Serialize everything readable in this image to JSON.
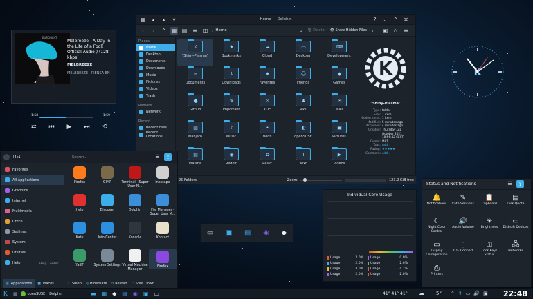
{
  "media": {
    "art_brand": "EUROBEAT",
    "title": "Melbreeze - A Day in the Life of a Fool( Official Audio ) (128 kbps)",
    "artist": "MELBREEZE",
    "album": "MELBREEZE - PIENSA EN",
    "time_elapsed": "1:58",
    "time_remaining": "-1:59",
    "progress": 0.5
  },
  "dolphin": {
    "title": "Home — Dolphin",
    "breadcrumb": "Home",
    "delete_label": "Delete",
    "show_hidden_label": "Show Hidden Files",
    "places_header": "Places",
    "places": [
      "Home",
      "Desktop",
      "Documents",
      "Downloads",
      "Music",
      "Pictures",
      "Videos",
      "Trash"
    ],
    "remote_header": "Remote",
    "remote": [
      "Network"
    ],
    "recent_header": "Recent",
    "recent": [
      "Recent Files",
      "Recent Locations"
    ],
    "files": [
      {
        "name": "\"Shiny-Plasma\"",
        "glyph": "K"
      },
      {
        "name": "Bookmarks",
        "glyph": "★"
      },
      {
        "name": "Cloud",
        "glyph": "☁"
      },
      {
        "name": "Desktop",
        "glyph": "▭"
      },
      {
        "name": "Development",
        "glyph": "⌨"
      },
      {
        "name": "Documents",
        "glyph": "≡"
      },
      {
        "name": "Downloads",
        "glyph": "↓"
      },
      {
        "name": "Favorites",
        "glyph": "★"
      },
      {
        "name": "Friends",
        "glyph": "☺"
      },
      {
        "name": "Games",
        "glyph": "◆"
      },
      {
        "name": "Github",
        "glyph": "●"
      },
      {
        "name": "Important",
        "glyph": "♛"
      },
      {
        "name": "KDE",
        "glyph": "⚙"
      },
      {
        "name": "l4k1",
        "glyph": "♟"
      },
      {
        "name": "Mail",
        "glyph": "✉"
      },
      {
        "name": "Manjaro",
        "glyph": "▥"
      },
      {
        "name": "Music",
        "glyph": "♪"
      },
      {
        "name": "Neon",
        "glyph": "•"
      },
      {
        "name": "openSUSE",
        "glyph": "◐"
      },
      {
        "name": "Pictures",
        "glyph": "▣"
      },
      {
        "name": "Plasma",
        "glyph": "▤"
      },
      {
        "name": "Reddit",
        "glyph": "◉"
      },
      {
        "name": "Relax",
        "glyph": "✿"
      },
      {
        "name": "Text",
        "glyph": "T"
      },
      {
        "name": "Videos",
        "glyph": "▶"
      }
    ],
    "info": {
      "name": "\"Shiny-Plasma\"",
      "rows": [
        {
          "k": "Type:",
          "v": "folder"
        },
        {
          "k": "Size:",
          "v": "1 item"
        },
        {
          "k": "Hidden items:",
          "v": "1 item"
        },
        {
          "k": "Modified:",
          "v": "5 minutes ago"
        },
        {
          "k": "Accessed:",
          "v": "4 minutes ago"
        },
        {
          "k": "Created:",
          "v": "Thursday, 21"
        },
        {
          "k": "",
          "v": "October 2021"
        },
        {
          "k": "",
          "v": "18:56:42 CEST"
        },
        {
          "k": "Owner:",
          "v": "l4k1"
        },
        {
          "k": "Tags:",
          "v": "Add..."
        },
        {
          "k": "Rating:",
          "v": "★★★★★"
        },
        {
          "k": "Comment:",
          "v": "Add..."
        }
      ]
    },
    "status_left": "25 Folders",
    "zoom_label": "Zoom:",
    "free_space": "123.2 GiB free"
  },
  "launcher": {
    "user": "l4k1",
    "search_placeholder": "Search...",
    "categories": [
      {
        "label": "Favorites",
        "color": "#e05260"
      },
      {
        "label": "All Applications",
        "color": "#3daee9"
      },
      {
        "label": "Graphics",
        "color": "#a060e0"
      },
      {
        "label": "Internet",
        "color": "#3daee9"
      },
      {
        "label": "Multimedia",
        "color": "#e06090"
      },
      {
        "label": "Office",
        "color": "#e0a030"
      },
      {
        "label": "Settings",
        "color": "#8a98a8"
      },
      {
        "label": "System",
        "color": "#c04848"
      },
      {
        "label": "Utilities",
        "color": "#e05a30"
      },
      {
        "label": "Help",
        "color": "#3daee9"
      }
    ],
    "help_center": "Help Center",
    "apps": [
      {
        "label": "Firefox",
        "color": "#ff7a1a"
      },
      {
        "label": "GIMP",
        "color": "#7a6a4a"
      },
      {
        "label": "Terminal - Super User M...",
        "color": "#c01818"
      },
      {
        "label": "Inkscape",
        "color": "#d0d0d0"
      },
      {
        "label": "Help",
        "color": "#e03030"
      },
      {
        "label": "Discover",
        "color": "#3daee9"
      },
      {
        "label": "Dolphin",
        "color": "#3a8fd8"
      },
      {
        "label": "File Manager - Super User M...",
        "color": "#3a8fd8"
      },
      {
        "label": "Kate",
        "color": "#2c8fe0"
      },
      {
        "label": "Info Center",
        "color": "#2c8fe0"
      },
      {
        "label": "Konsole",
        "color": "#30363e"
      },
      {
        "label": "Kontact",
        "color": "#e8e0c8"
      },
      {
        "label": "YaST",
        "color": "#3a9a6a"
      },
      {
        "label": "System Settings",
        "color": "#7a8898"
      },
      {
        "label": "Virtual Machine Manager",
        "color": "#f0f0f0"
      },
      {
        "label": "Firefox",
        "color": "#8a4ae0"
      }
    ],
    "tab_applications": "Applications",
    "tab_places": "Places",
    "sleep": "Sleep",
    "hibernate": "Hibernate",
    "restart": "Restart",
    "shutdown": "Shut Down"
  },
  "cores": {
    "title": "Individual Core Usage",
    "rows": [
      {
        "l": "Usage",
        "v": "2.0%",
        "l2": "Usage",
        "v2": "0.0%"
      },
      {
        "l": "Usage",
        "v": "2.0%",
        "l2": "Usage",
        "v2": "2.0%"
      },
      {
        "l": "Usage",
        "v": "4.0%",
        "l2": "Usage",
        "v2": "4.1%"
      },
      {
        "l": "Usage",
        "v": "2.0%",
        "l2": "Usage",
        "v2": "2.0%"
      }
    ],
    "colors": [
      "#e05a30",
      "#3daee9",
      "#e0c030",
      "#a060e0",
      "#60c060",
      "#e05260"
    ]
  },
  "tray": {
    "title": "Status and Notifications",
    "items": [
      {
        "label": "Notifications",
        "glyph": "🔔"
      },
      {
        "label": "Kate Sessions",
        "glyph": "✎"
      },
      {
        "label": "Clipboard",
        "glyph": "📋"
      },
      {
        "label": "Disk Quota",
        "glyph": "▤"
      },
      {
        "label": "Night Color Control",
        "glyph": "☾"
      },
      {
        "label": "Audio Volume",
        "glyph": "🔊"
      },
      {
        "label": "Brightness",
        "glyph": "☀"
      },
      {
        "label": "Disks & Devices",
        "glyph": "▭"
      },
      {
        "label": "Display Configuration",
        "glyph": "▭"
      },
      {
        "label": "KDE Connect",
        "glyph": "▯"
      },
      {
        "label": "Lock Keys Status",
        "glyph": "⚿"
      },
      {
        "label": "Networks",
        "glyph": "🖧"
      },
      {
        "label": "Printers",
        "glyph": "⎙"
      }
    ]
  },
  "taskbar": {
    "task1": "openSUSE",
    "task2": "Dolphin",
    "temp": "41° 41° 41°",
    "weather": "5°",
    "clock": "22:48"
  }
}
